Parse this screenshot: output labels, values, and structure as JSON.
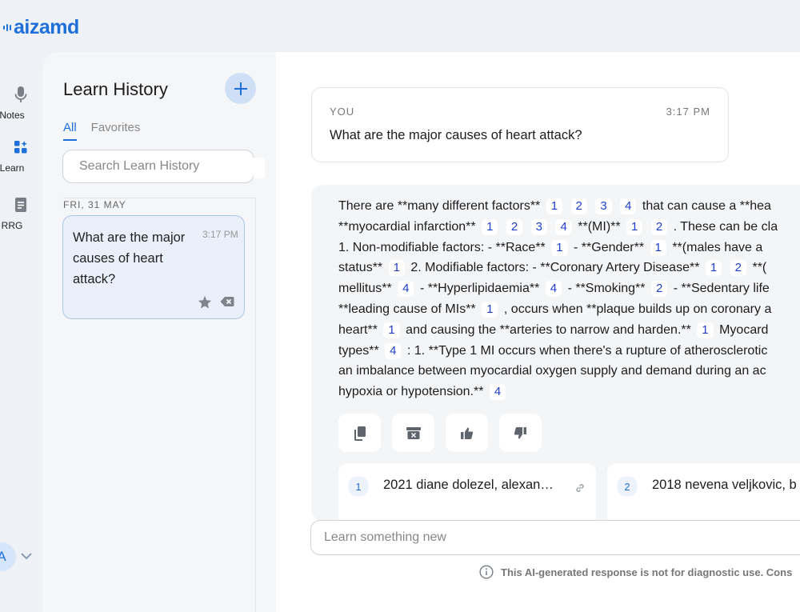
{
  "brand": {
    "logo_text": "aizamd",
    "accent": "#1e6fd9"
  },
  "nav": [
    {
      "label": "Notes",
      "icon": "microphone-icon",
      "active": false
    },
    {
      "label": "Learn",
      "icon": "apps-sparkle-icon",
      "active": true
    },
    {
      "label": "RRG",
      "icon": "document-icon",
      "active": false
    }
  ],
  "user": {
    "avatar_initial": "A"
  },
  "history": {
    "title": "Learn History",
    "tabs": [
      "All",
      "Favorites"
    ],
    "search_placeholder": "Search Learn History",
    "date_label": "FRI, 31 MAY",
    "items": [
      {
        "text": "What are the major causes of heart attack?",
        "time": "3:17 PM"
      }
    ]
  },
  "chat": {
    "you_label": "YOU",
    "you_time": "3:17 PM",
    "question": "What are the major causes of heart attack?",
    "answer_lines": [
      [
        {
          "t": "There are **many different factors**"
        },
        {
          "c": "1"
        },
        {
          "c": "2"
        },
        {
          "c": "3"
        },
        {
          "c": "4"
        },
        {
          "t": "that can cause a **hea"
        }
      ],
      [
        {
          "t": "**myocardial infarction**"
        },
        {
          "c": "1"
        },
        {
          "c": "2"
        },
        {
          "c": "3"
        },
        {
          "c": "4"
        },
        {
          "t": "**(MI)**"
        },
        {
          "c": "1"
        },
        {
          "c": "2"
        },
        {
          "t": ". These can be cla"
        }
      ],
      [
        {
          "t": "1. Non-modifiable factors: - **Race**"
        },
        {
          "c": "1"
        },
        {
          "t": "- **Gender**"
        },
        {
          "c": "1"
        },
        {
          "t": "**(males have a"
        }
      ],
      [
        {
          "t": "status**"
        },
        {
          "c": "1"
        },
        {
          "t": "2. Modifiable factors: - **Coronary Artery Disease**"
        },
        {
          "c": "1"
        },
        {
          "c": "2"
        },
        {
          "t": "**("
        }
      ],
      [
        {
          "t": "mellitus**"
        },
        {
          "c": "4"
        },
        {
          "t": "- **Hyperlipidaemia**"
        },
        {
          "c": "4"
        },
        {
          "t": "- **Smoking**"
        },
        {
          "c": "2"
        },
        {
          "t": "- **Sedentary life"
        }
      ],
      [
        {
          "t": "**leading cause of MIs**"
        },
        {
          "c": "1"
        },
        {
          "t": ", occurs when **plaque builds up on coronary a"
        }
      ],
      [
        {
          "t": "heart**"
        },
        {
          "c": "1"
        },
        {
          "t": "and causing the **arteries to narrow and harden.**"
        },
        {
          "c": "1"
        },
        {
          "t": "Myocard"
        }
      ],
      [
        {
          "t": "types**"
        },
        {
          "c": "4"
        },
        {
          "t": ": 1. **Type 1 MI occurs when there's a rupture of atherosclerotic"
        }
      ],
      [
        {
          "t": "an imbalance between myocardial oxygen supply and demand during an ac"
        }
      ],
      [
        {
          "t": "hypoxia or hypotension.**"
        },
        {
          "c": "4"
        }
      ]
    ],
    "actions": [
      {
        "name": "copy-button",
        "icon": "copy-icon"
      },
      {
        "name": "archive-button",
        "icon": "archive-icon"
      },
      {
        "name": "thumbs-up-button",
        "icon": "thumbs-up-icon"
      },
      {
        "name": "thumbs-down-button",
        "icon": "thumbs-down-icon"
      }
    ],
    "sources": [
      {
        "num": "1",
        "title": "2021 diane dolezel, alexan…"
      },
      {
        "num": "2",
        "title": "2018 nevena veljkovic, b"
      }
    ],
    "input_placeholder": "Learn something new",
    "disclaimer": "This AI-generated response is not for diagnostic use. Cons"
  }
}
